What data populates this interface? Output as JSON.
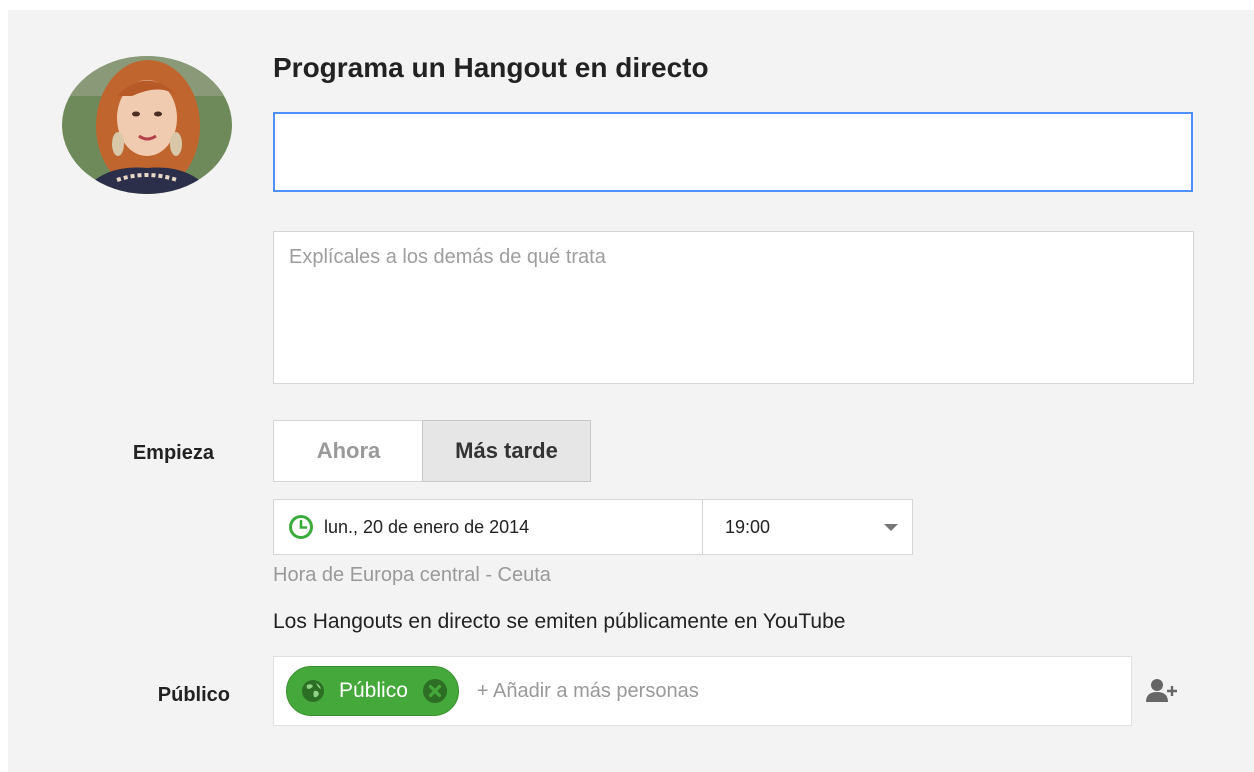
{
  "form": {
    "title": "Programa un Hangout en directo",
    "title_value": "",
    "description_placeholder": "Explícales a los demás de qué trata"
  },
  "start": {
    "label": "Empieza",
    "options": [
      "Ahora",
      "Más tarde"
    ],
    "selected": "Más tarde",
    "date": "lun., 20 de enero de 2014",
    "time": "19:00",
    "timezone": "Hora de Europa central - Ceuta"
  },
  "notice": "Los Hangouts en directo se emiten públicamente en YouTube",
  "audience": {
    "label": "Público",
    "chip_label": "Público",
    "add_placeholder": "+ Añadir a más personas"
  },
  "icons": {
    "clock": "clock-icon",
    "dropdown": "chevron-down-icon",
    "globe": "globe-icon",
    "remove": "close-icon",
    "add_person": "add-person-icon"
  },
  "colors": {
    "accent_blue": "#4d90fe",
    "chip_green": "#45a83a",
    "clock_green": "#3bac3b",
    "panel_bg": "#f3f3f3"
  }
}
